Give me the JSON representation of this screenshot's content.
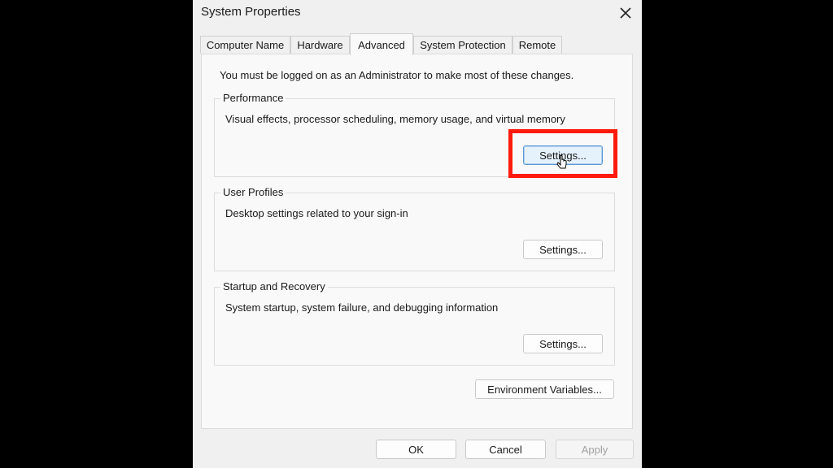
{
  "window": {
    "title": "System Properties",
    "close_icon": "close-icon"
  },
  "tabs": [
    {
      "label": "Computer Name",
      "active": false
    },
    {
      "label": "Hardware",
      "active": false
    },
    {
      "label": "Advanced",
      "active": true
    },
    {
      "label": "System Protection",
      "active": false
    },
    {
      "label": "Remote",
      "active": false
    }
  ],
  "advanced": {
    "admin_note": "You must be logged on as an Administrator to make most of these changes.",
    "performance": {
      "legend": "Performance",
      "description": "Visual effects, processor scheduling, memory usage, and virtual memory",
      "button": "Settings..."
    },
    "user_profiles": {
      "legend": "User Profiles",
      "description": "Desktop settings related to your sign-in",
      "button": "Settings..."
    },
    "startup_recovery": {
      "legend": "Startup and Recovery",
      "description": "System startup, system failure, and debugging information",
      "button": "Settings..."
    },
    "env_button": "Environment Variables..."
  },
  "footer": {
    "ok": "OK",
    "cancel": "Cancel",
    "apply": "Apply"
  },
  "colors": {
    "highlight": "#ff1a0d",
    "focus_border": "#5c9ad6"
  }
}
